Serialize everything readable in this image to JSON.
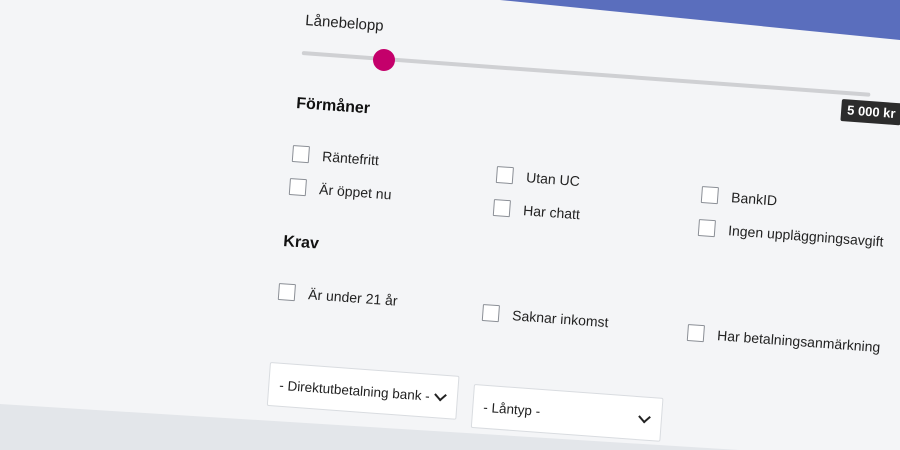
{
  "accent_color": "#c4006b",
  "band_color": "#5a6ebd",
  "slider": {
    "label": "Lånebelopp",
    "value": "5 000 kr",
    "fill_fraction": 0.14
  },
  "benefits": {
    "title": "Förmåner",
    "options": [
      {
        "label": "Räntefritt",
        "checked": false
      },
      {
        "label": "Är öppet nu",
        "checked": false
      },
      {
        "label": "Utan UC",
        "checked": false
      },
      {
        "label": "Har chatt",
        "checked": false
      },
      {
        "label": "BankID",
        "checked": false
      },
      {
        "label": "Ingen uppläggningsavgift",
        "checked": false
      }
    ]
  },
  "requirements": {
    "title": "Krav",
    "options": [
      {
        "label": "Är under 21 år",
        "checked": false
      },
      {
        "label": "Saknar inkomst",
        "checked": false
      },
      {
        "label": "Har betalningsanmärkning",
        "checked": false
      }
    ]
  },
  "filters": {
    "bank_select": {
      "selected": "- Direktutbetalning bank -",
      "icon": "chevron-down-icon"
    },
    "loantype_select": {
      "selected": "- Låntyp -",
      "icon": "chevron-down-icon"
    }
  }
}
